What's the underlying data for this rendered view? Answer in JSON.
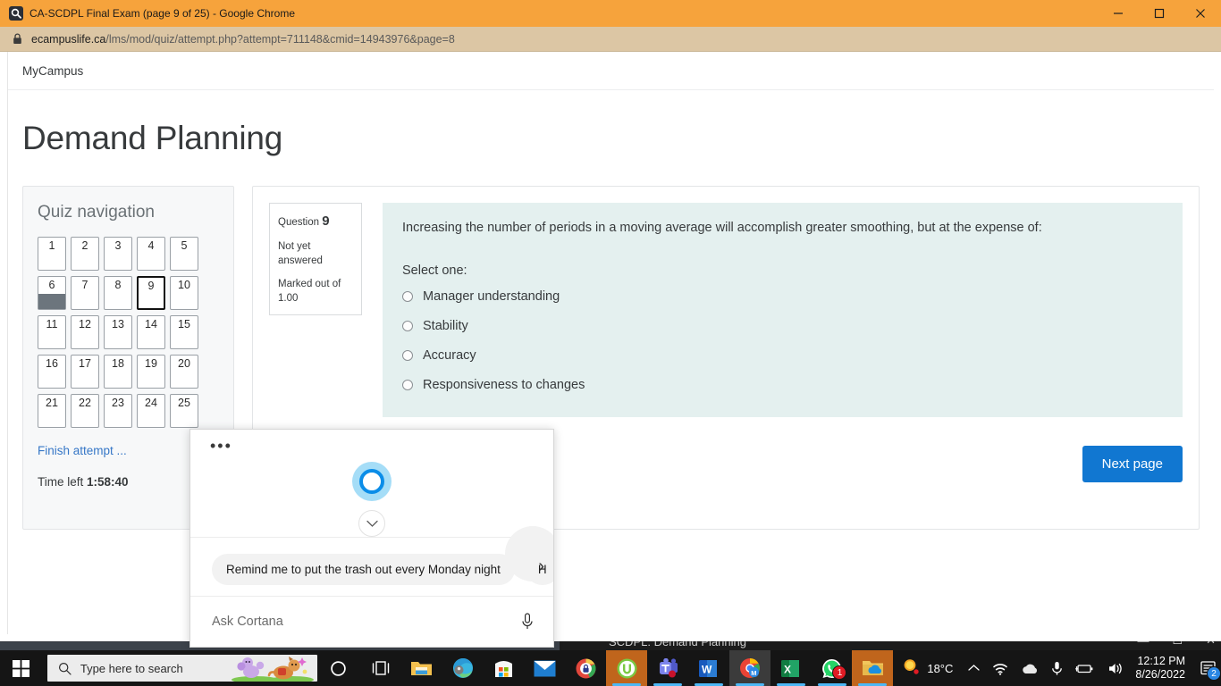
{
  "browser": {
    "tab_title": "CA-SCDPL Final Exam (page 9 of 25) - Google Chrome",
    "favicon_label": "CS",
    "url_domain": "ecampuslife.ca",
    "url_path": "/lms/mod/quiz/attempt.php?attempt=711148&cmid=14943976&page=8",
    "minimize_label": "—",
    "maximize_label": "☐",
    "close_label": "✕"
  },
  "background_window": {
    "title": "SCDPL: Demand Planning",
    "minimize_label": "—",
    "maximize_label": "☐",
    "close_label": "✕"
  },
  "site": {
    "brand": "MyCampus",
    "page_title": "Demand Planning"
  },
  "quiz_nav": {
    "title": "Quiz navigation",
    "buttons": [
      {
        "label": "1",
        "state": "not-answered"
      },
      {
        "label": "2",
        "state": "not-answered"
      },
      {
        "label": "3",
        "state": "not-answered"
      },
      {
        "label": "4",
        "state": "not-answered"
      },
      {
        "label": "5",
        "state": "not-answered"
      },
      {
        "label": "6",
        "state": "answered"
      },
      {
        "label": "7",
        "state": "not-answered"
      },
      {
        "label": "8",
        "state": "not-answered"
      },
      {
        "label": "9",
        "state": "current"
      },
      {
        "label": "10",
        "state": "not-answered"
      },
      {
        "label": "11",
        "state": "not-answered"
      },
      {
        "label": "12",
        "state": "not-answered"
      },
      {
        "label": "13",
        "state": "not-answered"
      },
      {
        "label": "14",
        "state": "not-answered"
      },
      {
        "label": "15",
        "state": "not-answered"
      },
      {
        "label": "16",
        "state": "not-answered"
      },
      {
        "label": "17",
        "state": "not-answered"
      },
      {
        "label": "18",
        "state": "not-answered"
      },
      {
        "label": "19",
        "state": "not-answered"
      },
      {
        "label": "20",
        "state": "not-answered"
      },
      {
        "label": "21",
        "state": "not-answered"
      },
      {
        "label": "22",
        "state": "not-answered"
      },
      {
        "label": "23",
        "state": "not-answered"
      },
      {
        "label": "24",
        "state": "not-answered"
      },
      {
        "label": "25",
        "state": "not-answered"
      }
    ],
    "finish_attempt": "Finish attempt ...",
    "time_left_label": "Time left ",
    "time_left_value": "1:58:40"
  },
  "question": {
    "info_prefix": "Question ",
    "number": "9",
    "status": "Not yet answered",
    "marks": "Marked out of 1.00",
    "text": "Increasing the number of periods in a moving average will accomplish greater smoothing, but at the expense of:",
    "select_one": "Select one:",
    "options": [
      {
        "label": "Manager understanding",
        "selected": false
      },
      {
        "label": "Stability",
        "selected": false
      },
      {
        "label": "Accuracy",
        "selected": false
      },
      {
        "label": "Responsiveness to changes",
        "selected": false
      }
    ],
    "next_page": "Next page"
  },
  "cortana": {
    "more_label": "•••",
    "suggestion_1": "Remind me to put the trash out every Monday night",
    "suggestion_2": "H",
    "scroll_arrow": "›",
    "input_placeholder": "Ask Cortana"
  },
  "taskbar": {
    "search_placeholder": "Type here to search",
    "apps": [
      {
        "name": "file-explorer",
        "badge": null
      },
      {
        "name": "edge",
        "badge": null
      },
      {
        "name": "microsoft-store",
        "badge": null
      },
      {
        "name": "mail",
        "badge": null
      },
      {
        "name": "password-manager",
        "badge": null
      },
      {
        "name": "utorrent",
        "badge": null
      },
      {
        "name": "microsoft-teams",
        "badge": null
      },
      {
        "name": "microsoft-word",
        "badge": null
      },
      {
        "name": "google-chrome",
        "badge": null
      },
      {
        "name": "microsoft-excel",
        "badge": null
      },
      {
        "name": "whatsapp",
        "badge": "1"
      },
      {
        "name": "onedrive-folder",
        "badge": null
      }
    ],
    "weather_temp": "18°C",
    "clock_time": "12:12 PM",
    "clock_date": "8/26/2022",
    "notification_count": "2"
  },
  "colors": {
    "chrome_titlebar": "#f6a33c",
    "chrome_toolbar": "#dcc6a4",
    "question_bg": "#e4f0ef",
    "accent_button": "#1177d1",
    "link": "#3677c7",
    "answered_fill": "#6c757d",
    "cortana_ring": "#0b8de8",
    "cortana_halo": "#a5ddf7",
    "taskbar": "#151515"
  }
}
